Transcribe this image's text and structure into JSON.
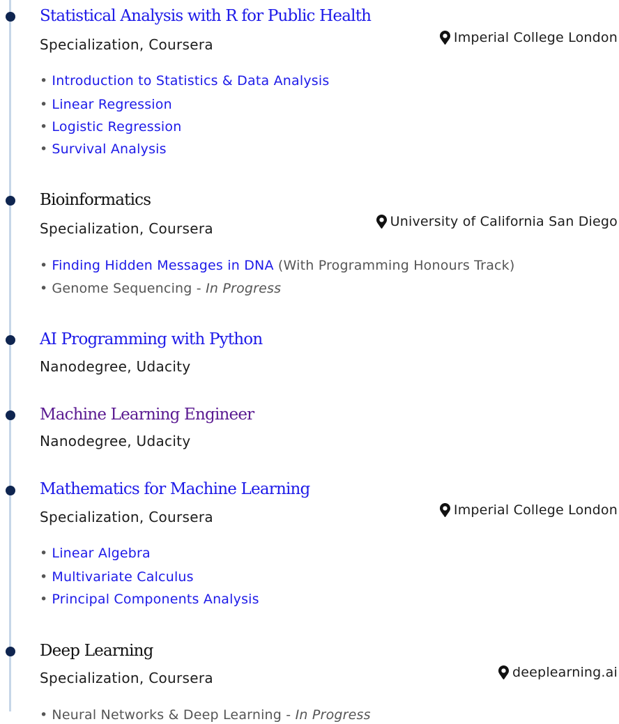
{
  "entries": [
    {
      "title": "Statistical Analysis with R for Public Health",
      "subtitle": "Specialization, Coursera",
      "location": "Imperial College London",
      "courses": [
        {
          "name": "Introduction to Statistics & Data Analysis"
        },
        {
          "name": "Linear Regression"
        },
        {
          "name": "Logistic Regression"
        },
        {
          "name": "Survival Analysis"
        }
      ]
    },
    {
      "title": "Bioinformatics",
      "subtitle": "Specialization, Coursera",
      "location": "University of California San Diego",
      "courses": [
        {
          "name": "Finding Hidden Messages in DNA",
          "note": "(With Programming Honours Track)"
        },
        {
          "name": "Genome Sequencing",
          "status": "In Progress",
          "separator": " - "
        }
      ]
    },
    {
      "title": "AI Programming with Python",
      "subtitle": "Nanodegree, Udacity"
    },
    {
      "title": "Machine Learning Engineer",
      "subtitle": "Nanodegree, Udacity"
    },
    {
      "title": "Mathematics for Machine Learning",
      "subtitle": "Specialization, Coursera",
      "location": "Imperial College London",
      "courses": [
        {
          "name": "Linear Algebra"
        },
        {
          "name": "Multivariate Calculus"
        },
        {
          "name": "Principal Components Analysis"
        }
      ]
    },
    {
      "title": "Deep Learning",
      "subtitle": "Specialization, Coursera",
      "location": "deeplearning.ai",
      "courses": [
        {
          "name": "Neural Networks & Deep Learning",
          "status": "In Progress",
          "separator": " - "
        }
      ]
    }
  ],
  "bullet": "•",
  "icons": {
    "location": "map-pin-icon"
  },
  "colors": {
    "link": "#1d1ae8",
    "visited_link": "#5a1a91",
    "dot": "#0f2550",
    "timeline": "#c6d6e8",
    "muted_text": "#555555"
  }
}
